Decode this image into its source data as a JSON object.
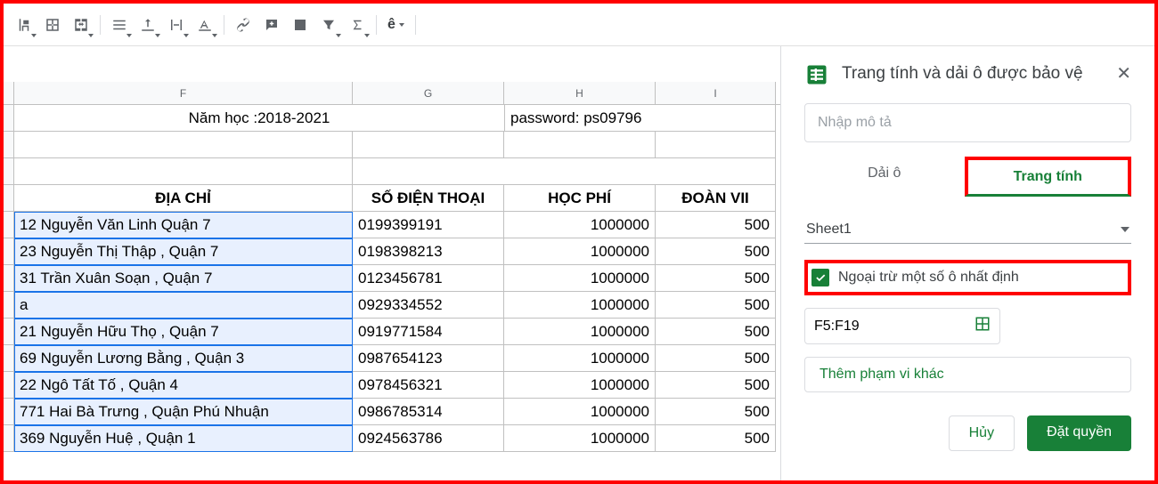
{
  "columns": {
    "f": "F",
    "g": "G",
    "h": "H",
    "i": "I"
  },
  "merged": {
    "year": "Năm học :2018-2021",
    "password": "password: ps09796"
  },
  "headers": {
    "f": "ĐỊA CHỈ",
    "g": "SỐ ĐIỆN THOẠI",
    "h": "HỌC PHÍ",
    "i": "ĐOÀN VII"
  },
  "rows": [
    {
      "f": "12 Nguyễn Văn Linh Quận 7",
      "g": "0199399191",
      "h": "1000000",
      "i": "500"
    },
    {
      "f": "23 Nguyễn Thị Thập , Quận 7",
      "g": "0198398213",
      "h": "1000000",
      "i": "500"
    },
    {
      "f": "31 Trần Xuân Soạn , Quận 7",
      "g": "0123456781",
      "h": "1000000",
      "i": "500"
    },
    {
      "f": "a",
      "g": "0929334552",
      "h": "1000000",
      "i": "500"
    },
    {
      "f": "21 Nguyễn Hữu Thọ , Quận 7",
      "g": "0919771584",
      "h": "1000000",
      "i": "500"
    },
    {
      "f": "69 Nguyễn Lương Bằng , Quận 3",
      "g": "0987654123",
      "h": "1000000",
      "i": "500"
    },
    {
      "f": "22 Ngô Tất Tố , Quận 4",
      "g": "0978456321",
      "h": "1000000",
      "i": "500"
    },
    {
      "f": "771 Hai Bà Trưng , Quận Phú Nhuận",
      "g": "0986785314",
      "h": "1000000",
      "i": "500"
    },
    {
      "f": "369 Nguyễn Huệ , Quận 1",
      "g": "0924563786",
      "h": "1000000",
      "i": "500"
    }
  ],
  "sidepanel": {
    "title": "Trang tính và dải ô được bảo vệ",
    "desc_placeholder": "Nhập mô tả",
    "tab_range": "Dải ô",
    "tab_sheet": "Trang tính",
    "sheet_selected": "Sheet1",
    "except_label": "Ngoại trừ một số ô nhất định",
    "range_value": "F5:F19",
    "add_more": "Thêm phạm vi khác",
    "cancel": "Hủy",
    "submit": "Đặt quyền"
  },
  "toolbar": {
    "letter": "ê"
  }
}
